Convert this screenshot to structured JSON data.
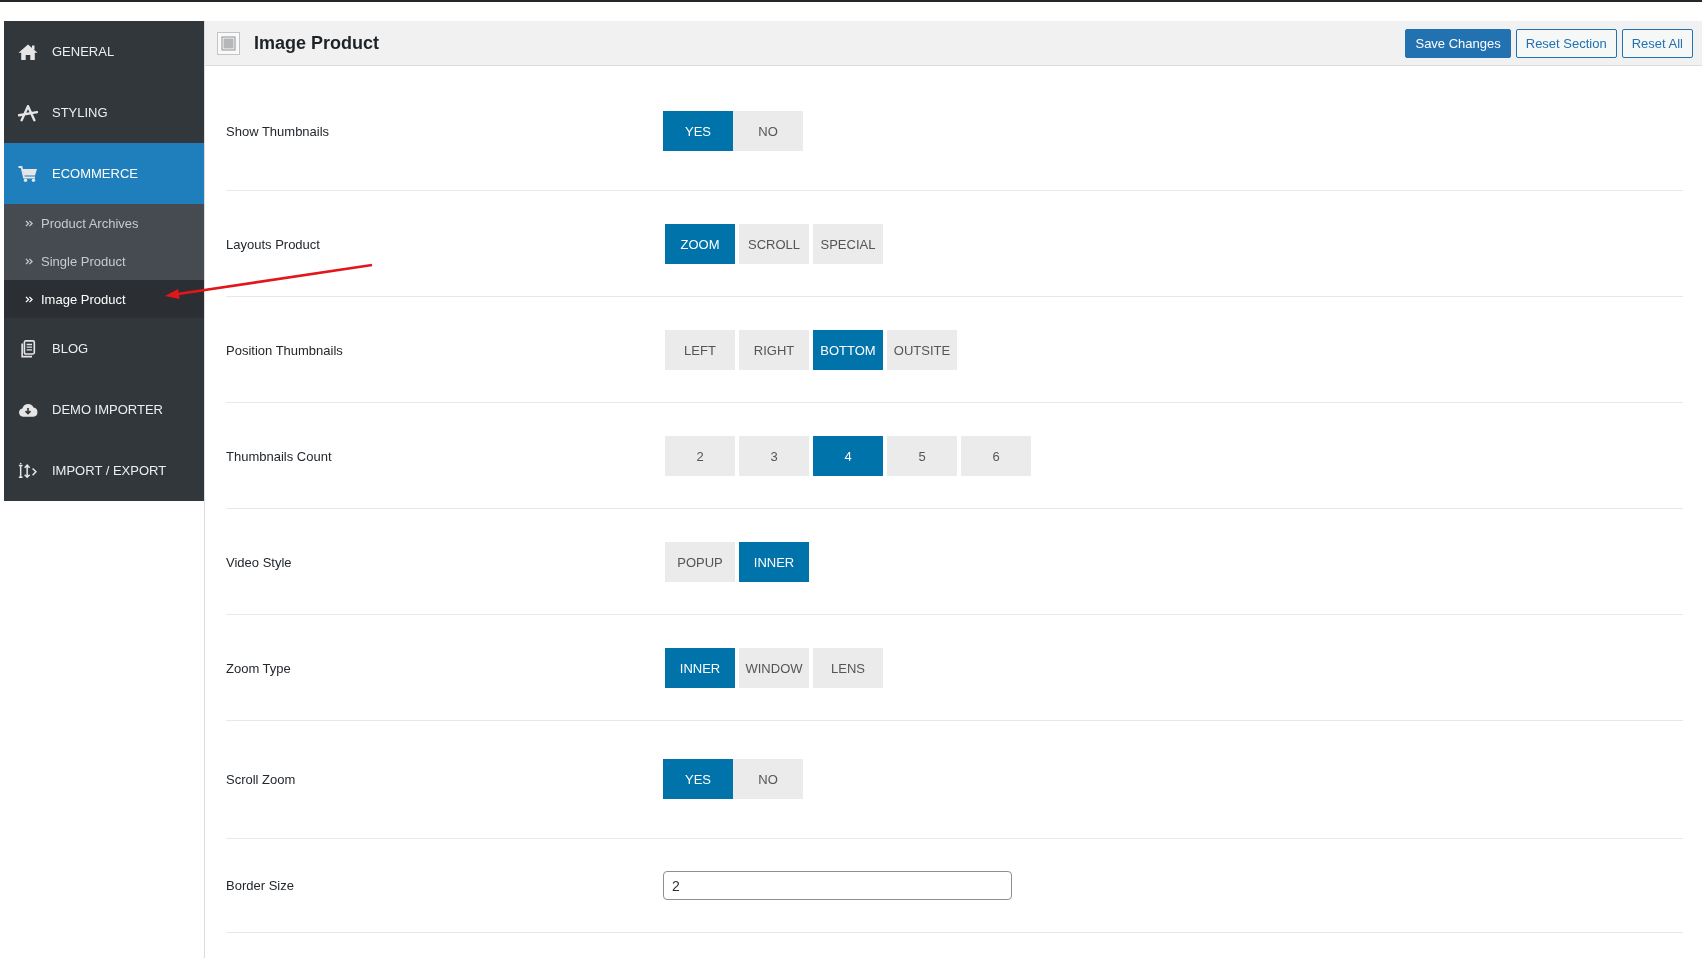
{
  "sidebar": {
    "items": [
      {
        "label": "GENERAL",
        "selected": false
      },
      {
        "label": "STYLING",
        "selected": false
      },
      {
        "label": "ECOMMERCE",
        "selected": true,
        "children": [
          {
            "label": "Product Archives",
            "selected": false
          },
          {
            "label": "Single Product",
            "selected": false
          },
          {
            "label": "Image Product",
            "selected": true
          }
        ]
      },
      {
        "label": "BLOG",
        "selected": false
      },
      {
        "label": "DEMO IMPORTER",
        "selected": false
      },
      {
        "label": "IMPORT / EXPORT",
        "selected": false
      }
    ]
  },
  "header": {
    "title": "Image Product",
    "buttons": [
      {
        "label": "Save Changes",
        "kind": "primary"
      },
      {
        "label": "Reset Section",
        "kind": "secondary"
      },
      {
        "label": "Reset All",
        "kind": "secondary"
      }
    ]
  },
  "settings": [
    {
      "label": "Show Thumbnails",
      "kind": "switch",
      "options": [
        {
          "label": "YES",
          "selected": true
        },
        {
          "label": "NO",
          "selected": false
        }
      ]
    },
    {
      "label": "Layouts Product",
      "kind": "buttonset",
      "options": [
        {
          "label": "ZOOM",
          "selected": true
        },
        {
          "label": "SCROLL",
          "selected": false
        },
        {
          "label": "SPECIAL",
          "selected": false
        }
      ]
    },
    {
      "label": "Position Thumbnails",
      "kind": "buttonset",
      "options": [
        {
          "label": "LEFT",
          "selected": false
        },
        {
          "label": "RIGHT",
          "selected": false
        },
        {
          "label": "BOTTOM",
          "selected": true
        },
        {
          "label": "OUTSITE",
          "selected": false
        }
      ]
    },
    {
      "label": "Thumbnails Count",
      "kind": "buttonset",
      "options": [
        {
          "label": "2",
          "selected": false
        },
        {
          "label": "3",
          "selected": false
        },
        {
          "label": "4",
          "selected": true
        },
        {
          "label": "5",
          "selected": false
        },
        {
          "label": "6",
          "selected": false
        }
      ]
    },
    {
      "label": "Video Style",
      "kind": "buttonset",
      "options": [
        {
          "label": "POPUP",
          "selected": false
        },
        {
          "label": "INNER",
          "selected": true
        }
      ]
    },
    {
      "label": "Zoom Type",
      "kind": "buttonset",
      "options": [
        {
          "label": "INNER",
          "selected": true
        },
        {
          "label": "WINDOW",
          "selected": false
        },
        {
          "label": "LENS",
          "selected": false
        }
      ]
    },
    {
      "label": "Scroll Zoom",
      "kind": "switch",
      "options": [
        {
          "label": "YES",
          "selected": true
        },
        {
          "label": "NO",
          "selected": false
        }
      ]
    },
    {
      "label": "Border Size",
      "kind": "text",
      "value": "2"
    }
  ]
}
